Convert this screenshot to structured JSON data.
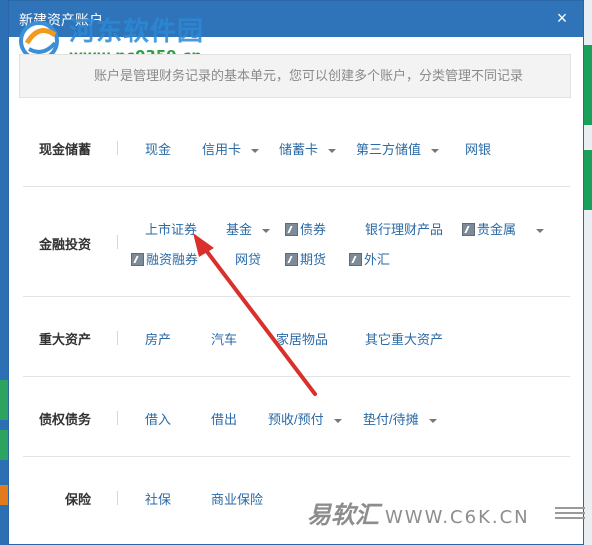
{
  "dialog": {
    "title": "新建资产账户",
    "close_label": "×",
    "info_text": "账户是管理财务记录的基本单元，您可以创建多个账户，分类管理不同记录"
  },
  "watermark": {
    "site_name": "河东软件园",
    "site_url": "www.pc0359.cn",
    "bottom_cn": "易软汇",
    "bottom_en": "WWW.C6K.CN"
  },
  "sections": {
    "cash": {
      "label": "现金储蓄",
      "items": [
        "现金",
        "信用卡",
        "储蓄卡",
        "第三方储值",
        "网银"
      ]
    },
    "invest": {
      "label": "金融投资",
      "items": [
        "上市证券",
        "基金",
        "债券",
        "银行理财产品",
        "贵金属",
        "融资融券",
        "网贷",
        "期货",
        "外汇"
      ]
    },
    "assets": {
      "label": "重大资产",
      "items": [
        "房产",
        "汽车",
        "家居物品",
        "其它重大资产"
      ]
    },
    "debt": {
      "label": "债权债务",
      "items": [
        "借入",
        "借出",
        "预收/预付",
        "垫付/待摊"
      ]
    },
    "insurance": {
      "label": "保险",
      "items": [
        "社保",
        "商业保险"
      ]
    }
  },
  "colors": {
    "title_bar": "#2f74b9",
    "link": "#2a6aa6",
    "arrow": "#d9302c"
  }
}
